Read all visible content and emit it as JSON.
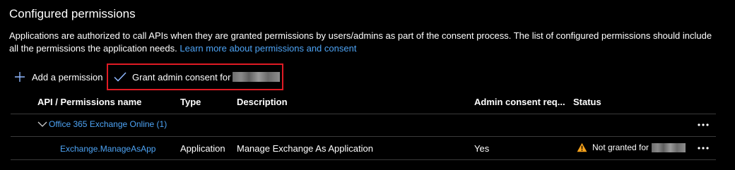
{
  "section": {
    "title": "Configured permissions",
    "description": "Applications are authorized to call APIs when they are granted permissions by users/admins as part of the consent process. The list of configured permissions should include all the permissions the application needs.",
    "learn_more_link": "Learn more about permissions and consent"
  },
  "toolbar": {
    "add_permission_label": "Add a permission",
    "grant_consent_label": "Grant admin consent for"
  },
  "table": {
    "columns": [
      "API / Permissions name",
      "Type",
      "Description",
      "Admin consent req...",
      "Status"
    ],
    "group": {
      "label": "Office 365 Exchange Online (1)"
    },
    "rows": [
      {
        "name": "Exchange.ManageAsApp",
        "type": "Application",
        "description": "Manage Exchange As Application",
        "admin_consent_required": "Yes",
        "status": "Not granted for"
      }
    ]
  },
  "icons": {
    "add": "plus-icon",
    "grant": "checkmark-icon",
    "expand": "chevron-down-icon",
    "more": "more-icon",
    "status": "warning-icon"
  },
  "colors": {
    "background": "#000000",
    "link": "#4ea4f5",
    "highlight_border": "#e01b24",
    "warning": "#f7a21b"
  }
}
